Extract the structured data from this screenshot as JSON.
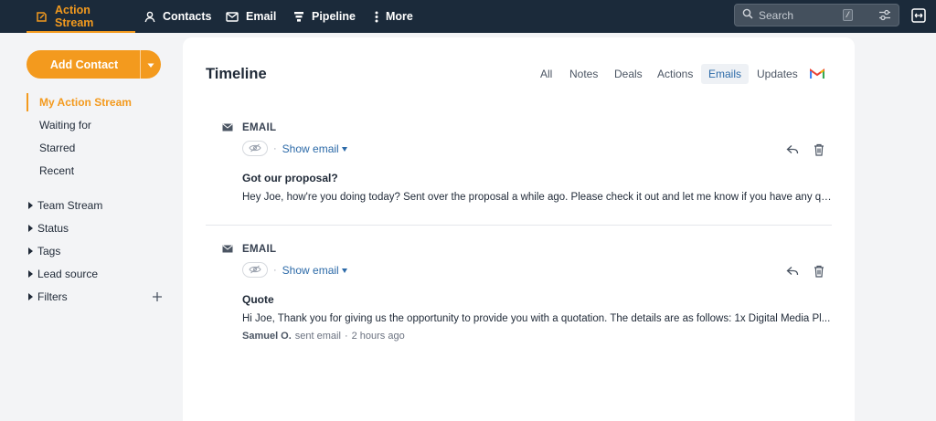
{
  "nav": {
    "items": [
      {
        "label": "Action Stream",
        "icon": "action-stream-icon"
      },
      {
        "label": "Contacts",
        "icon": "contacts-icon"
      },
      {
        "label": "Email",
        "icon": "envelope-icon"
      },
      {
        "label": "Pipeline",
        "icon": "pipeline-icon"
      },
      {
        "label": "More",
        "icon": "kebab-icon"
      }
    ],
    "search_placeholder": "Search",
    "search_shortcut": "/"
  },
  "sidebar": {
    "add_contact_label": "Add Contact",
    "links": [
      "My Action Stream",
      "Waiting for",
      "Starred",
      "Recent"
    ],
    "groups": [
      "Team Stream",
      "Status",
      "Tags",
      "Lead source",
      "Filters"
    ]
  },
  "timeline": {
    "title": "Timeline",
    "tabs": [
      "All",
      "Notes",
      "Deals",
      "Actions",
      "Emails",
      "Updates"
    ],
    "active_tab": "Emails",
    "entries": [
      {
        "type": "EMAIL",
        "show_label": "Show email",
        "subject": "Got our proposal?",
        "preview": "Hey Joe, how're you doing today? Sent over the proposal a while ago. Please check it out and let me know if you have any qu...",
        "sender": "",
        "action": "",
        "time": ""
      },
      {
        "type": "EMAIL",
        "show_label": "Show email",
        "subject": "Quote",
        "preview": "Hi Joe, Thank you for giving us the opportunity to provide you with a quotation. The details are as follows: 1x Digital Media Pl...",
        "sender": "Samuel O.",
        "action": "sent email",
        "time": "2 hours ago"
      }
    ]
  },
  "colors": {
    "topbar": "#1b2a3a",
    "accent": "#f39a1e",
    "link": "#2c6aa8"
  }
}
